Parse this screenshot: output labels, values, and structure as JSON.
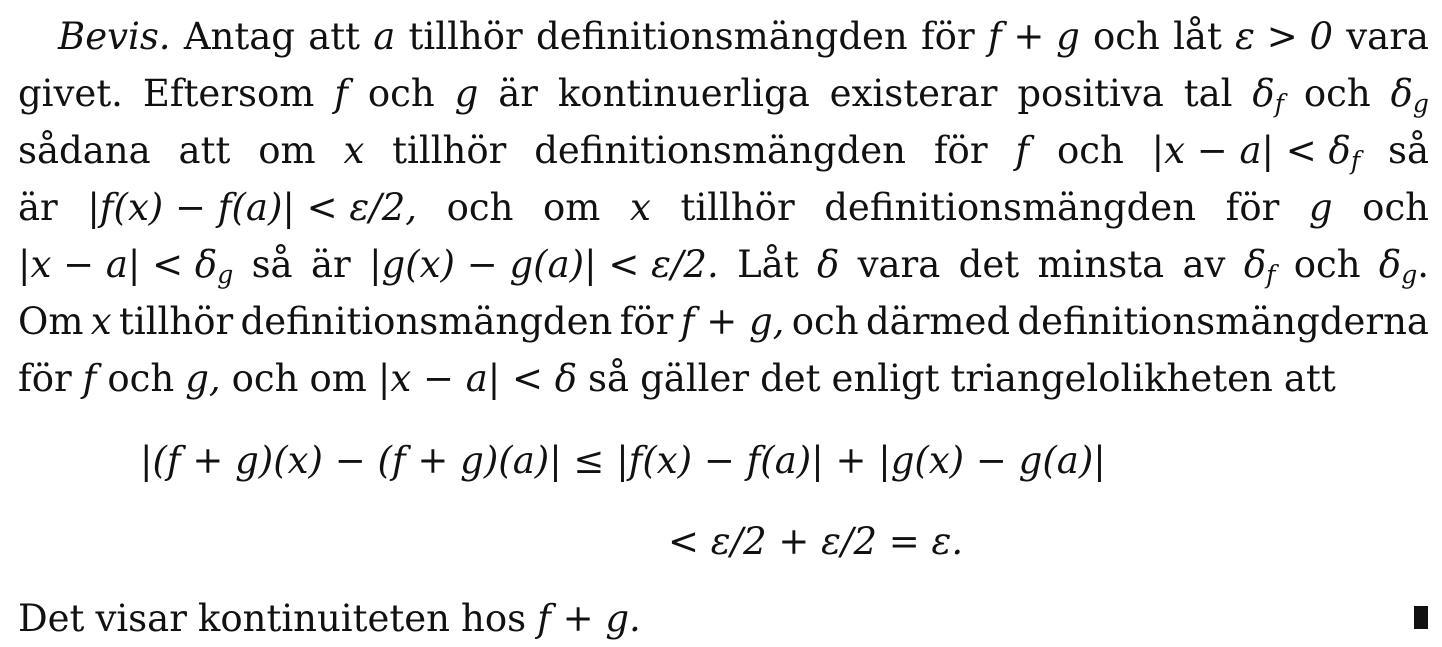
{
  "proof": {
    "label": "Bevis.",
    "line1": [
      "Antag",
      "att",
      "a",
      "tillhör",
      "definitionsmängden",
      "för",
      "f + g",
      "och",
      "låt",
      "ε > 0",
      "vara"
    ],
    "line2": [
      "givet.",
      "Eftersom",
      "f",
      "och",
      "g",
      "är",
      "kontinuerliga",
      "existerar",
      "positiva",
      "tal",
      "δ",
      "f",
      "och",
      "δ",
      "g"
    ],
    "line3": [
      "sådana",
      "att",
      "om",
      "x",
      "tillhör",
      "definitionsmängden",
      "för",
      "f",
      "och",
      "|x − a| < δ",
      "f",
      "så"
    ],
    "line4": [
      "är",
      "|f(x) − f(a)| < ε/2,",
      "och",
      "om",
      "x",
      "tillhör",
      "definitionsmängden",
      "för",
      "g",
      "och"
    ],
    "line5": [
      "|x − a| < δ",
      "g",
      "så",
      "är",
      "|g(x) − g(a)| < ε/2.",
      "Låt",
      "δ",
      "vara",
      "det",
      "minsta",
      "av",
      "δ",
      "f",
      "och",
      "δ",
      "g",
      "."
    ],
    "line6": [
      "Om",
      "x",
      "tillhör",
      "definitionsmängden",
      "för",
      "f + g,",
      "och",
      "därmed",
      "definitionsmängderna"
    ],
    "line7": [
      "för",
      "f",
      "och",
      "g,",
      "och",
      "om",
      "|x − a| < δ",
      "så",
      "gäller",
      "det",
      "enligt",
      "triangelolikheten",
      "att"
    ],
    "display1": "|(f + g)(x) − (f + g)(a)| ≤ |f(x) − f(a)| + |g(x) − g(a)|",
    "display2": "< ε/2 + ε/2 = ε.",
    "closing": [
      "Det",
      "visar",
      "kontinuiteten",
      "hos",
      "f + g."
    ]
  }
}
